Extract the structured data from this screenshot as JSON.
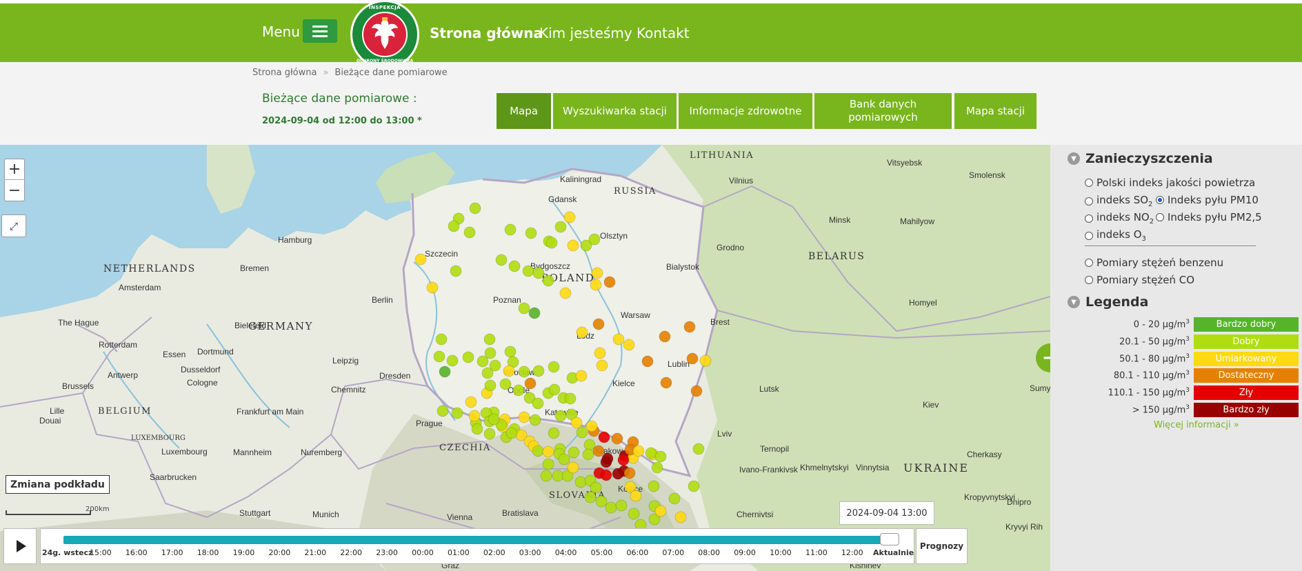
{
  "header": {
    "menu_label": "Menu",
    "logo_text_top": "INSPEKCJA",
    "logo_text_bottom": "OCHRONY ŚRODOWISKA",
    "nav": [
      "Strona główna",
      "Kim jesteśmy",
      "Kontakt"
    ]
  },
  "breadcrumb": [
    "Strona główna",
    "»",
    "Bieżące dane pomiarowe"
  ],
  "page": {
    "title": "Bieżące dane pomiarowe :",
    "date": "2024-09-04 od 12:00 do 13:00 *"
  },
  "tabs": [
    {
      "label": "Mapa",
      "active": true
    },
    {
      "label": "Wyszukiwarka stacji",
      "active": false
    },
    {
      "label": "Informacje zdrowotne",
      "active": false
    },
    {
      "label": "Bank danych pomiarowych",
      "active": false
    },
    {
      "label": "Mapa stacji",
      "active": false
    }
  ],
  "map": {
    "zoom_in": "+",
    "zoom_out": "−",
    "fullscreen_icon": "expand-icon",
    "basemap_button": "Zmiana podkładu",
    "scale_label": "200km",
    "time_readout": "2024-09-04 13:00",
    "labels": {
      "countries": [
        "LITHUANIA",
        "RUSSIA",
        "BELARUS",
        "NETHERLANDS",
        "GERMANY",
        "BELGIUM",
        "POLAND",
        "CZECHIA",
        "SLOVAKIA",
        "UKRAINE",
        "LUXEMBOURG"
      ],
      "cities": [
        "Kaliningrad",
        "Vilnius",
        "Vitsyebsk",
        "Smolensk",
        "Gdansk",
        "Minsk",
        "Mahilyow",
        "Hamburg",
        "Szczecin",
        "Bydgoszcz",
        "Grodno",
        "Bialystok",
        "Bremen",
        "Amsterdam",
        "Berlin",
        "Poznan",
        "Warsaw",
        "Homyel",
        "The Hague",
        "Rotterdam",
        "Bielefeld",
        "Brest",
        "Essen",
        "Dortmund",
        "Dusseldorf",
        "Leipzig",
        "Dresden",
        "Wroclaw",
        "Lodz",
        "Lublin",
        "Antwerp",
        "Cologne",
        "Brussels",
        "Chemnitz",
        "Kielce",
        "Lutsk",
        "Lille",
        "Frankfurt am Main",
        "Prague",
        "Lviv",
        "Kiev",
        "Douai",
        "Krakow",
        "Ternopil",
        "Mannheim",
        "Nuremberg",
        "Luxembourg",
        "Khmelnytskyi",
        "Vinnytsia",
        "Cherkasy",
        "Saarbrucken",
        "Ivano-Frankivsk",
        "Kosice",
        "Stuttgart",
        "Munich",
        "Vienna",
        "Bratislava",
        "Chernivtsi",
        "Kropyvnytskyi",
        "Dnipro",
        "Kryvyi Rih",
        "Sumy",
        "Graz",
        "Kishinev",
        "Katowice",
        "Opole",
        "Olsztyn"
      ]
    }
  },
  "timeline": {
    "start_label": "24g. wstecz",
    "ticks": [
      "15:00",
      "16:00",
      "17:00",
      "18:00",
      "19:00",
      "20:00",
      "21:00",
      "22:00",
      "23:00",
      "00:00",
      "01:00",
      "02:00",
      "03:00",
      "04:00",
      "05:00",
      "06:00",
      "07:00",
      "08:00",
      "09:00",
      "10:00",
      "11:00",
      "12:00"
    ],
    "end_label": "Aktualnie",
    "position_fraction": 1.0,
    "forecast_button": "Prognozy"
  },
  "panel": {
    "pollutants_heading": "Zanieczyszczenia",
    "options": [
      {
        "label": "Polski indeks jakości powietrza",
        "selected": false
      },
      {
        "label": "indeks SO",
        "sub": "2",
        "selected": false
      },
      {
        "label": "Indeks pyłu PM10",
        "selected": true
      },
      {
        "label": "indeks NO",
        "sub": "2",
        "selected": false
      },
      {
        "label": "Indeks pyłu PM2,5",
        "selected": false
      },
      {
        "label": "indeks O",
        "sub": "3",
        "selected": false
      },
      {
        "label": "Pomiary stężeń benzenu",
        "selected": false
      },
      {
        "label": "Pomiary stężeń CO",
        "selected": false
      }
    ],
    "legend_heading": "Legenda",
    "legend_unit": "µg/m",
    "legend_unit_sup": "3",
    "legend": [
      {
        "range": "0 - 20 µg/m",
        "label": "Bardzo dobry",
        "color": "#57b32a"
      },
      {
        "range": "20.1 - 50 µg/m",
        "label": "Dobry",
        "color": "#b0dd10"
      },
      {
        "range": "50.1 - 80 µg/m",
        "label": "Umiarkowany",
        "color": "#ffd911"
      },
      {
        "range": "80.1 - 110 µg/m",
        "label": "Dostateczny",
        "color": "#e58100"
      },
      {
        "range": "110.1 - 150 µg/m",
        "label": "Zły",
        "color": "#e50000"
      },
      {
        "range": "> 150 µg/m",
        "label": "Bardzo zły",
        "color": "#990000"
      }
    ],
    "more_info": "Więcej informacji »"
  },
  "colors": {
    "brand_green": "#79b51d",
    "active_tab": "#5e9618",
    "timeline_track": "#16a9b7"
  }
}
